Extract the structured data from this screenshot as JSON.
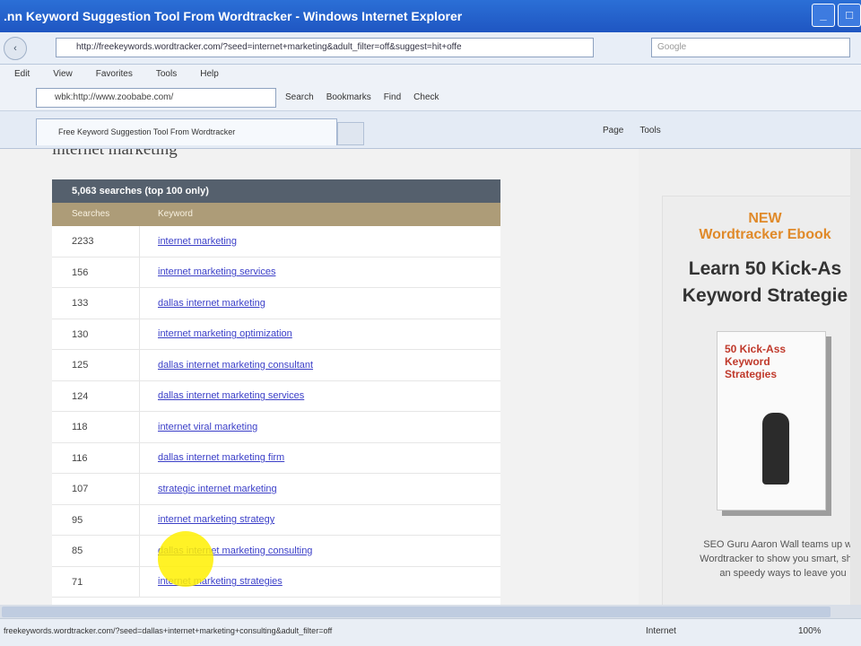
{
  "window": {
    "title": ".nn Keyword Suggestion Tool From Wordtracker - Windows Internet Explorer"
  },
  "address": {
    "url": "http://freekeywords.wordtracker.com/?seed=internet+marketing&adult_filter=off&suggest=hit+offe",
    "search_placeholder": "Google"
  },
  "menu": [
    "Edit",
    "View",
    "Favorites",
    "Tools",
    "Help"
  ],
  "googlebar": {
    "search_value": "wbk:http://www.zoobabe.com/",
    "items": [
      "Search",
      "Bookmarks",
      "Find",
      "Check"
    ]
  },
  "tab": {
    "label": "Free Keyword Suggestion Tool From Wordtracker"
  },
  "tools": [
    "Page",
    "Tools"
  ],
  "page": {
    "heading": "internet marketing",
    "table_title": "5,063 searches (top 100 only)",
    "columns": [
      "Searches",
      "Keyword"
    ],
    "rows": [
      {
        "searches": "2233",
        "keyword": "internet marketing"
      },
      {
        "searches": "156",
        "keyword": "internet marketing services"
      },
      {
        "searches": "133",
        "keyword": "dallas internet marketing"
      },
      {
        "searches": "130",
        "keyword": "internet marketing optimization"
      },
      {
        "searches": "125",
        "keyword": "dallas internet marketing consultant"
      },
      {
        "searches": "124",
        "keyword": "dallas internet marketing services"
      },
      {
        "searches": "118",
        "keyword": "internet viral marketing"
      },
      {
        "searches": "116",
        "keyword": "dallas internet marketing firm"
      },
      {
        "searches": "107",
        "keyword": "strategic internet marketing"
      },
      {
        "searches": "95",
        "keyword": "internet marketing strategy"
      },
      {
        "searches": "85",
        "keyword": "dallas internet marketing consulting"
      },
      {
        "searches": "71",
        "keyword": "internet marketing strategies"
      }
    ]
  },
  "ad": {
    "new": "NEW",
    "sub": "Wordtracker Ebook",
    "title_line1": "Learn 50 Kick-As",
    "title_line2": "Keyword Strategie",
    "book_title": "50 Kick-Ass Keyword Strategies",
    "text": "SEO Guru Aaron Wall teams up with Wordtracker to show you smart, sharp an speedy ways to leave you"
  },
  "status": {
    "link": "freekeywords.wordtracker.com/?seed=dallas+internet+marketing+consulting&adult_filter=off",
    "zone": "Internet",
    "zoom": "100%"
  }
}
